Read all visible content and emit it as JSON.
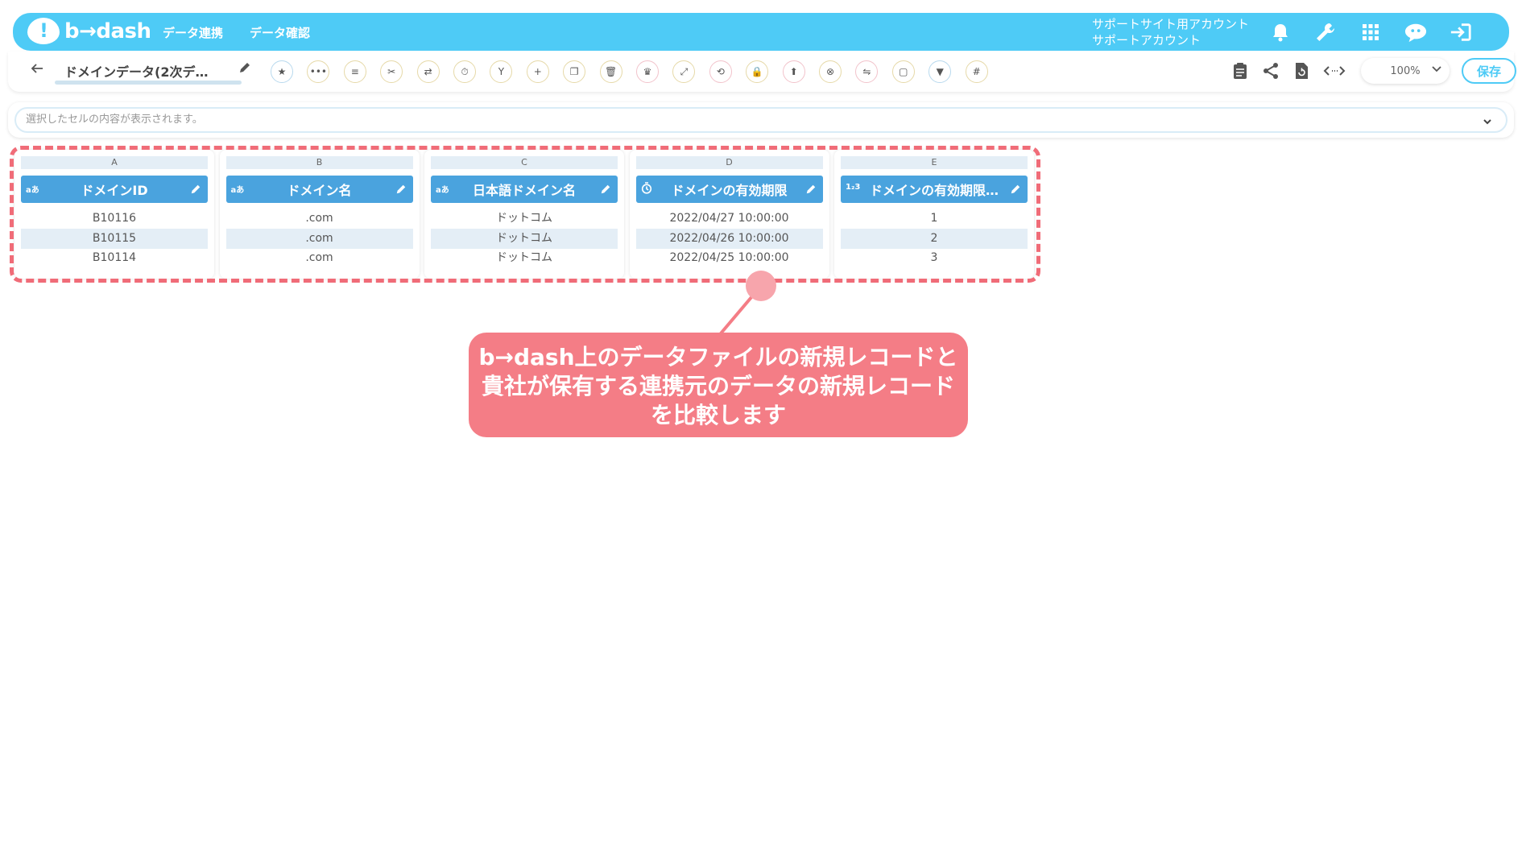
{
  "header": {
    "logo_text": "b→dash",
    "nav": [
      "データ連携",
      "データ確認"
    ],
    "account_line1": "サポートサイト用アカウント",
    "account_line2": "サポートアカウント",
    "icons": [
      "bell-icon",
      "wrench-icon",
      "apps-grid-icon",
      "chat-bot-icon",
      "logout-icon"
    ],
    "color": "#4ecbf6"
  },
  "toolbar": {
    "back_icon": "arrow-left-icon",
    "file_name": "ドメインデータ(2次デ…",
    "zoom": "100%",
    "save_label": "保存",
    "tool_icons": [
      "star-icon",
      "dots-icon",
      "list-icon",
      "scissors-icon",
      "transform-icon",
      "timer-icon",
      "branch-icon",
      "plus-icon",
      "copy-icon",
      "trash-icon",
      "crown-icon",
      "expand-icon",
      "repeat-icon",
      "lock-icon",
      "upload-icon",
      "close-circle-icon",
      "swap-icon",
      "frame-icon",
      "filter-icon",
      "grid-icon"
    ],
    "right_icons": [
      "clipboard-icon",
      "share-icon",
      "refresh-icon",
      "code-icon"
    ]
  },
  "cellbar": {
    "placeholder": "選択したセルの内容が表示されます。"
  },
  "table": {
    "columns": [
      {
        "letter": "A",
        "type": "aあ",
        "header": "ドメインID",
        "cells": [
          "B10116",
          "B10115",
          "B10114"
        ]
      },
      {
        "letter": "B",
        "type": "aあ",
        "header": "ドメイン名",
        "cells": [
          ".com",
          ".com",
          ".com"
        ]
      },
      {
        "letter": "C",
        "type": "aあ",
        "header": "日本語ドメイン名",
        "cells": [
          "ドットコム",
          "ドットコム",
          "ドットコム"
        ]
      },
      {
        "letter": "D",
        "type": "timer",
        "header": "ドメインの有効期限",
        "cells": [
          "2022/04/27 10:00:00",
          "2022/04/26 10:00:00",
          "2022/04/25 10:00:00"
        ]
      },
      {
        "letter": "E",
        "type": "1₂3",
        "header": "ドメインの有効期限…",
        "cells": [
          "1",
          "2",
          "3"
        ]
      }
    ]
  },
  "callout": {
    "lines": [
      "b→dash上のデータファイルの新規レコードと",
      "貴社が保有する連携元のデータの新規レコード",
      "を比較します"
    ],
    "color": "#f47d86"
  }
}
